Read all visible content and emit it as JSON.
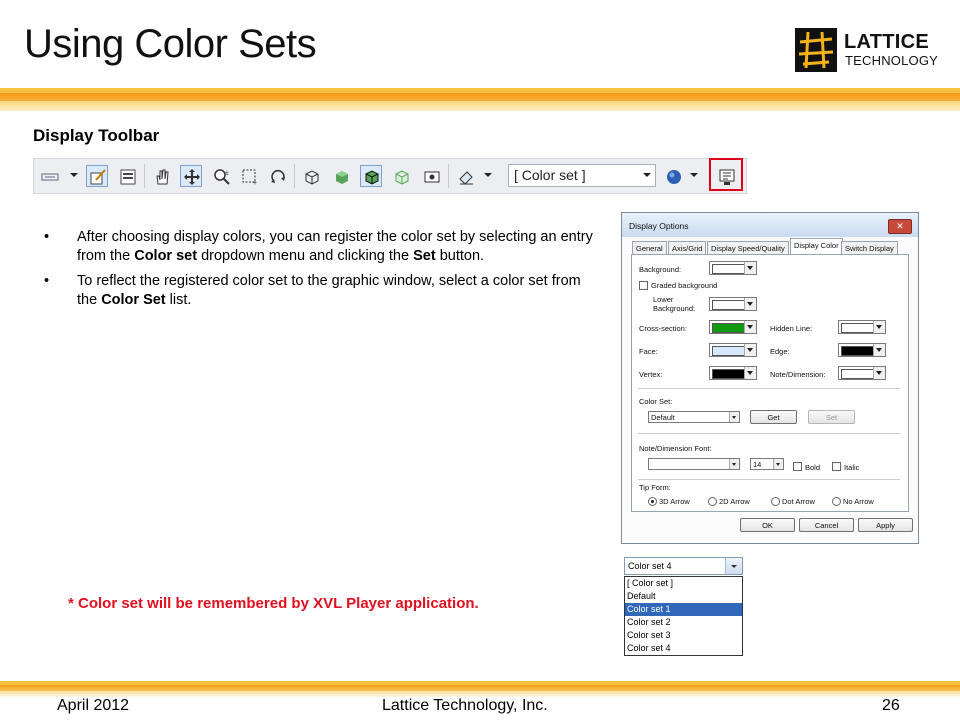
{
  "slide": {
    "title": "Using Color Sets",
    "subheading": "Display Toolbar",
    "logo": {
      "line1": "LATTICE",
      "line2": "TECHNOLOGY"
    },
    "bullets": [
      {
        "parts": [
          "After choosing display colors, you can register the color set by selecting an entry from the ",
          "Color set",
          " dropdown menu and clicking the ",
          "Set",
          " button."
        ]
      },
      {
        "parts": [
          "To reflect the registered color set to the graphic window, select a color set from the ",
          "Color Set",
          " list."
        ]
      }
    ],
    "bullet_glyph": "•",
    "note": "* Color set will be remembered by XVL Player application.",
    "footer": {
      "date": "April 2012",
      "company": "Lattice Technology, Inc.",
      "page": "26"
    },
    "accent_colors": {
      "highlight_red": "#e0001a",
      "band_orange": "#f29a14",
      "note_red": "#e0101e"
    }
  },
  "toolbar": {
    "colorset_value": "[ Color set ]",
    "icons": [
      "toolbar-menu-icon",
      "edit-icon",
      "panel-icon",
      "hand-pan-icon",
      "move-icon",
      "zoom-icon",
      "zoom-box-icon",
      "rotate-icon",
      "wireframe-icon",
      "shaded-icon",
      "shaded-edges-icon",
      "transparent-icon",
      "vertex-icon",
      "eraser-icon",
      "sphere-icon",
      "display-options-icon"
    ]
  },
  "dialog": {
    "title": "Display Options",
    "close": "✕",
    "tabs": [
      "General",
      "Axis/Grid",
      "Display Speed/Quality",
      "Display Color",
      "Switch Display"
    ],
    "active_tab": "Display Color",
    "labels": {
      "background": "Background:",
      "graded_background": "Graded background",
      "lower_background": "Lower Background:",
      "cross_section": "Cross-section:",
      "hidden_line": "Hidden Line:",
      "face": "Face:",
      "edge": "Edge:",
      "vertex": "Vertex:",
      "note_dimension": "Note/Dimension:",
      "color_set": "Color Set:",
      "note_dimension_font": "Note/Dimension Font:",
      "tip_form": "Tip Form:"
    },
    "colors": {
      "background": "#ffffff",
      "lower_background": "#ffffff",
      "cross_section": "#129a12",
      "hidden_line": "#ffffff",
      "face": "#d6e8fa",
      "edge": "#000000",
      "vertex": "#000000",
      "note_dimension": "#ffffff"
    },
    "color_set_value": "Default",
    "get_button": "Get",
    "set_button": "Set",
    "font_size": "14",
    "bold": "Bold",
    "italic": "Italic",
    "tip_options": [
      "3D Arrow",
      "2D Arrow",
      "Dot Arrow",
      "No Arrow"
    ],
    "tip_selected": "3D Arrow",
    "ok": "OK",
    "cancel": "Cancel",
    "apply": "Apply"
  },
  "color_set_list": {
    "current": "Color set 4",
    "items": [
      "[ Color set ]",
      "Default",
      "Color set 1",
      "Color set 2",
      "Color set 3",
      "Color set 4"
    ],
    "selected": "Color set 1"
  }
}
